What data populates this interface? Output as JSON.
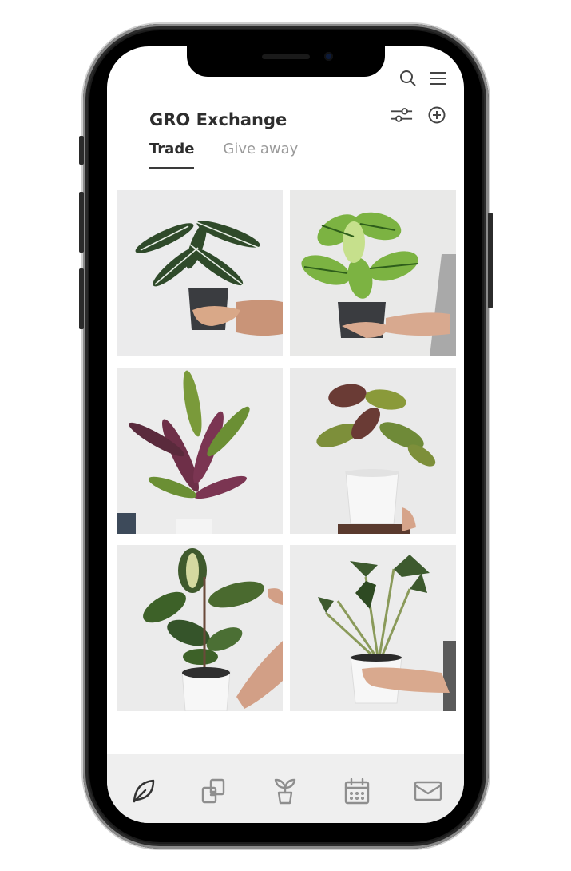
{
  "app": {
    "title": "GRO Exchange"
  },
  "tabs": [
    {
      "label": "Trade",
      "active": true
    },
    {
      "label": "Give away",
      "active": false
    }
  ],
  "header_icons": [
    "search-icon",
    "menu-icon",
    "filter-icon",
    "add-circle-icon"
  ],
  "grid": {
    "items": [
      {
        "name": "plant-listing-1",
        "plant": "white-striped-calathea"
      },
      {
        "name": "plant-listing-2",
        "plant": "zebra-calathea"
      },
      {
        "name": "plant-listing-3",
        "plant": "rattlesnake-calathea"
      },
      {
        "name": "plant-listing-4",
        "plant": "peacock-calathea"
      },
      {
        "name": "plant-listing-5",
        "plant": "variegated-rubber-plant"
      },
      {
        "name": "plant-listing-6",
        "plant": "alocasia"
      }
    ]
  },
  "bottom_nav": [
    {
      "icon": "leaf-icon",
      "active": true
    },
    {
      "icon": "exchange-icon",
      "active": false
    },
    {
      "icon": "seedling-pot-icon",
      "active": false
    },
    {
      "icon": "calendar-icon",
      "active": false
    },
    {
      "icon": "mail-icon",
      "active": false
    }
  ],
  "colors": {
    "text_primary": "#2d2d2d",
    "text_muted": "#9a9a9a",
    "nav_active": "#333333",
    "nav_inactive": "#8e8e8e",
    "nav_bg": "#efefef",
    "leaf_green": "#3f7a2c"
  }
}
